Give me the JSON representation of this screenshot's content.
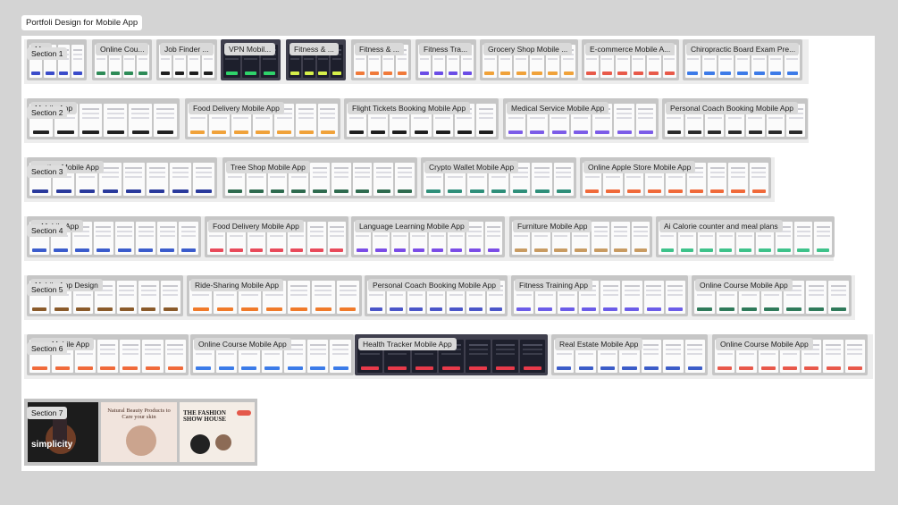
{
  "page": {
    "title": "Portfoli Design for Mobile App"
  },
  "sections": [
    {
      "label": "Section 1",
      "frames": [
        {
          "label": "M...",
          "accent": "#3b4cca"
        },
        {
          "label": "Online Cou...",
          "accent": "#2e8b57"
        },
        {
          "label": "Job Finder ...",
          "accent": "#1f1f1f"
        },
        {
          "label": "VPN Mobil...",
          "accent": "#2fd36b",
          "dark": true
        },
        {
          "label": "Fitness & ...",
          "accent": "#d6f04a",
          "dark": true
        },
        {
          "label": "Fitness & ...",
          "accent": "#f07a3a"
        },
        {
          "label": "Fitness Tra...",
          "accent": "#6b4de6"
        },
        {
          "label": "Grocery Shop Mobile ...",
          "accent": "#f0a23a"
        },
        {
          "label": "E-commerce Mobile A...",
          "accent": "#e85a4a"
        },
        {
          "label": "Chiropractic Board Exam Pre...",
          "accent": "#3d7be8"
        }
      ]
    },
    {
      "label": "Section 2",
      "frames": [
        {
          "label": "Mobile App",
          "accent": "#222222"
        },
        {
          "label": "Food Delivery Mobile App",
          "accent": "#f0a23a"
        },
        {
          "label": "Flight Tickets Booking Mobile App",
          "accent": "#1f1f1f"
        },
        {
          "label": "Medical Service Mobile App",
          "accent": "#7c5ce8"
        },
        {
          "label": "Personal Coach Booking Mobile App",
          "accent": "#2b2b2b"
        }
      ]
    },
    {
      "label": "Section 3",
      "frames": [
        {
          "label": "ucation Mobile App",
          "accent": "#2a3a9c"
        },
        {
          "label": "Tree Shop Mobile App",
          "accent": "#2f6b4f"
        },
        {
          "label": "Crypto Wallet Mobile App",
          "accent": "#2f8f7a"
        },
        {
          "label": "Online Apple Store Mobile App",
          "accent": "#f06a3a"
        }
      ]
    },
    {
      "label": "Section 4",
      "frames": [
        {
          "label": "e Mobile App",
          "accent": "#3b5ccc"
        },
        {
          "label": "Food Delivery Mobile App",
          "accent": "#e84a5a"
        },
        {
          "label": "Language Learning Mobile App",
          "accent": "#7b4de6"
        },
        {
          "label": "Furniture Mobile App",
          "accent": "#c89b62"
        },
        {
          "label": "Ai Calorie counter and meal plans",
          "accent": "#3ec28a"
        }
      ]
    },
    {
      "label": "Section 5",
      "frames": [
        {
          "label": "Mobile App Design",
          "accent": "#8a5a2a"
        },
        {
          "label": "Ride-Sharing Mobile App",
          "accent": "#f07a2a"
        },
        {
          "label": "Personal Coach Booking Mobile App",
          "accent": "#4a55c8"
        },
        {
          "label": "Fitness Training App",
          "accent": "#6b5ce8"
        },
        {
          "label": "Online Course Mobile App",
          "accent": "#2f7a5a"
        }
      ]
    },
    {
      "label": "Section 6",
      "frames": [
        {
          "label": "urse Mobile App",
          "accent": "#f06a3a"
        },
        {
          "label": "Online Course Mobile App",
          "accent": "#3b7be8"
        },
        {
          "label": "Health Tracker Mobile App",
          "accent": "#e83a4a",
          "dark": true
        },
        {
          "label": "Real Estate Mobile App",
          "accent": "#3b5cc8"
        },
        {
          "label": "Online Course Mobile App",
          "accent": "#e8584a"
        }
      ]
    }
  ],
  "section7": {
    "label": "Section 7",
    "posters": [
      {
        "text": "simplicity"
      },
      {
        "text": "Natural Beauty Products to Care your skin"
      },
      {
        "text": "THE FASHION SHOW HOUSE"
      }
    ]
  }
}
